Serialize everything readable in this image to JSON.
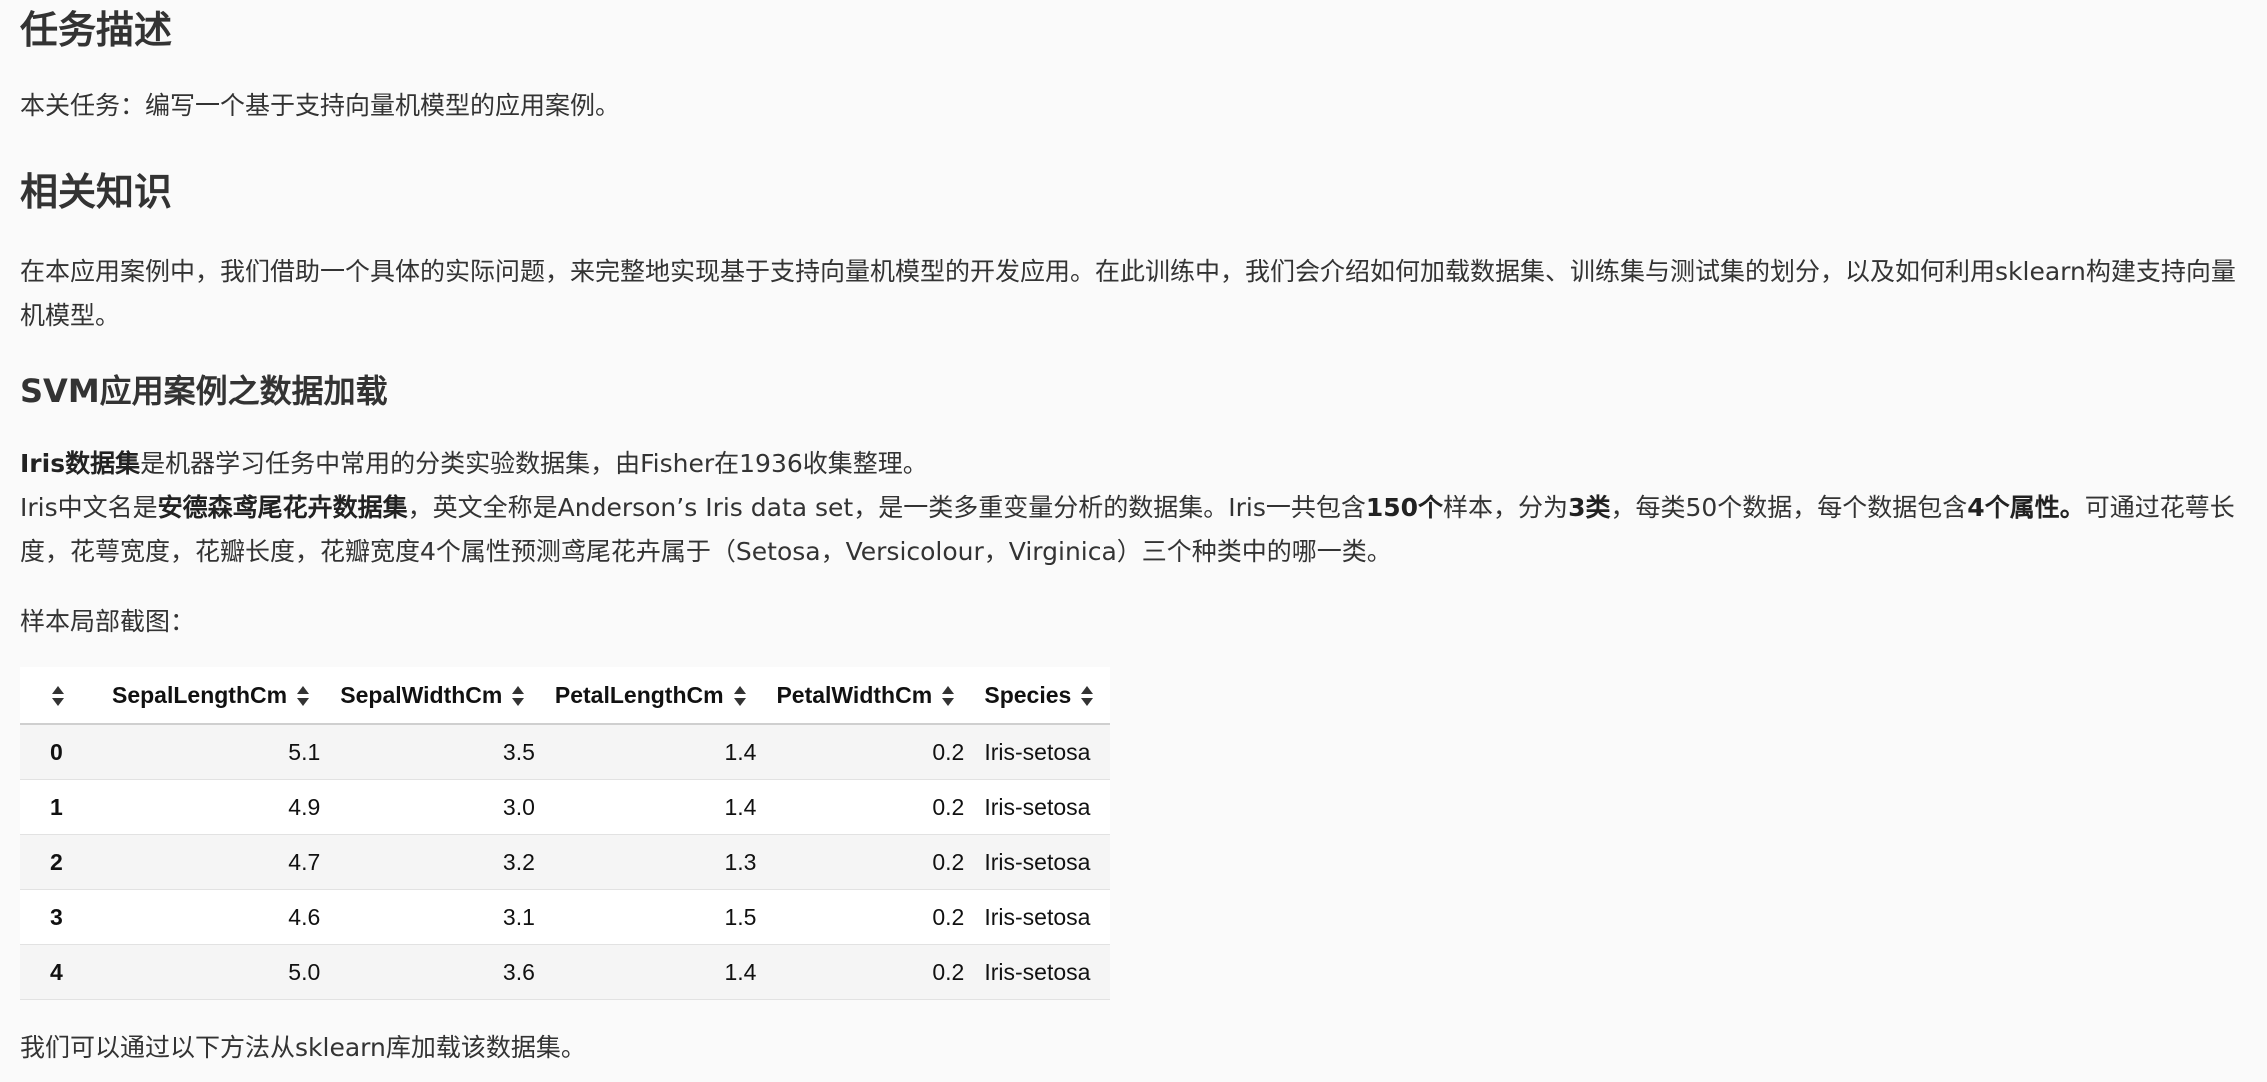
{
  "section_task": {
    "heading": "任务描述",
    "text": "本关任务：编写一个基于支持向量机模型的应用案例。"
  },
  "section_knowledge": {
    "heading": "相关知识",
    "text": "在本应用案例中，我们借助一个具体的实际问题，来完整地实现基于支持向量机模型的开发应用。在此训练中，我们会介绍如何加载数据集、训练集与测试集的划分，以及如何利用sklearn构建支持向量机模型。"
  },
  "section_svm": {
    "heading": "SVM应用案例之数据加载",
    "line1_bold": "Iris数据集",
    "line1_rest": "是机器学习任务中常用的分类实验数据集，由Fisher在1936收集整理。",
    "line2_a": "Iris中文名是",
    "line2_b_bold": "安德森鸢尾花卉数据集",
    "line2_c": "，英文全称是Anderson’s Iris data set，是一类多重变量分析的数据集。Iris一共包含",
    "line2_d_bold": "150个",
    "line2_e": "样本，分为",
    "line2_f_bold": "3类",
    "line2_g": "，每类50个数据，每个数据包含",
    "line2_h_bold": "4个属性。",
    "line2_i": "可通过花萼长度，花萼宽度，花瓣长度，花瓣宽度4个属性预测鸢尾花卉属于（Setosa，Versicolour，Virginica）三个种类中的哪一类。",
    "sample_caption": "样本局部截图：",
    "load_text": "我们可以通过以下方法从sklearn库加载该数据集。"
  },
  "table": {
    "columns": [
      "",
      "SepalLengthCm",
      "SepalWidthCm",
      "PetalLengthCm",
      "PetalWidthCm",
      "Species"
    ],
    "rows": [
      [
        "0",
        "5.1",
        "3.5",
        "1.4",
        "0.2",
        "Iris-setosa"
      ],
      [
        "1",
        "4.9",
        "3.0",
        "1.4",
        "0.2",
        "Iris-setosa"
      ],
      [
        "2",
        "4.7",
        "3.2",
        "1.3",
        "0.2",
        "Iris-setosa"
      ],
      [
        "3",
        "4.6",
        "3.1",
        "1.5",
        "0.2",
        "Iris-setosa"
      ],
      [
        "4",
        "5.0",
        "3.6",
        "1.4",
        "0.2",
        "Iris-setosa"
      ]
    ]
  },
  "icons": {
    "sort": "sort-icon"
  }
}
